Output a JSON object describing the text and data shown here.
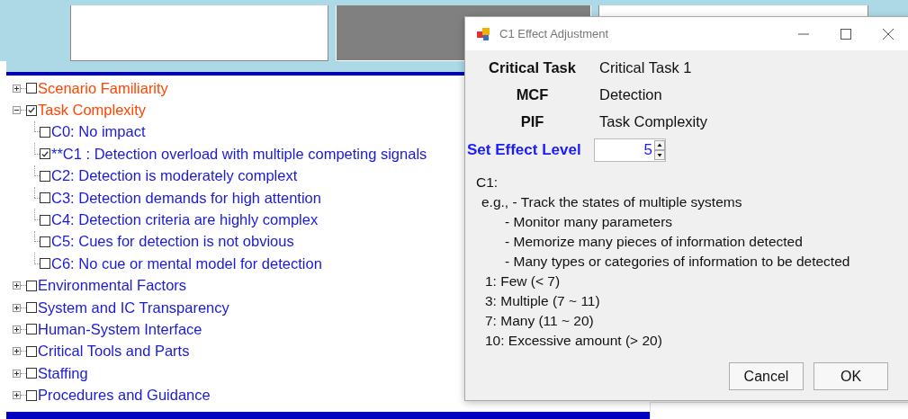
{
  "tree": [
    {
      "label": "Scenario Familiarity",
      "checked": false,
      "expanded": false,
      "color": "#ff4500"
    },
    {
      "label": "Task Complexity",
      "checked": true,
      "expanded": true,
      "color": "#ff4500",
      "children": [
        {
          "label": "C0: No impact",
          "checked": false,
          "color": "#1a1ad8"
        },
        {
          "label": "**C1 : Detection overload with multiple competing signals",
          "checked": true,
          "color": "#1a1ad8"
        },
        {
          "label": "C2: Detection is moderately complext",
          "checked": false,
          "color": "#1a1ad8"
        },
        {
          "label": "C3: Detection demands for high attention",
          "checked": false,
          "color": "#1a1ad8"
        },
        {
          "label": "C4: Detection criteria are highly complex",
          "checked": false,
          "color": "#1a1ad8"
        },
        {
          "label": "C5: Cues for detection is not obvious",
          "checked": false,
          "color": "#1a1ad8"
        },
        {
          "label": "C6: No cue or mental model for detection",
          "checked": false,
          "color": "#1a1ad8"
        }
      ]
    },
    {
      "label": "Environmental Factors",
      "checked": false,
      "expanded": false,
      "color": "#1a1ad8"
    },
    {
      "label": "System and IC Transparency",
      "checked": false,
      "expanded": false,
      "color": "#1a1ad8"
    },
    {
      "label": "Human-System Interface",
      "checked": false,
      "expanded": false,
      "color": "#1a1ad8"
    },
    {
      "label": "Critical Tools and Parts",
      "checked": false,
      "expanded": false,
      "color": "#1a1ad8"
    },
    {
      "label": "Staffing",
      "checked": false,
      "expanded": false,
      "color": "#1a1ad8"
    },
    {
      "label": "Procedures and Guidance",
      "checked": false,
      "expanded": false,
      "color": "#1a1ad8"
    }
  ],
  "dialog": {
    "title": "C1 Effect Adjustment",
    "fields": [
      {
        "label": "Critical Task",
        "value": "Critical Task 1"
      },
      {
        "label": "MCF",
        "value": "Detection"
      },
      {
        "label": "PIF",
        "value": "Task Complexity"
      }
    ],
    "effect_level": {
      "label": "Set Effect Level",
      "value": "5"
    },
    "description": [
      {
        "kind": "head",
        "text": "C1:"
      },
      {
        "kind": "example",
        "text": "e.g., - Track the states of multiple systems"
      },
      {
        "kind": "sub",
        "text": "- Monitor many parameters"
      },
      {
        "kind": "sub",
        "text": "- Memorize many pieces of information detected"
      },
      {
        "kind": "sub",
        "text": "- Many types or categories of information to be detected"
      },
      {
        "kind": "level",
        "text": "1: Few (< 7)"
      },
      {
        "kind": "level",
        "text": "3: Multiple (7 ~ 11)"
      },
      {
        "kind": "level",
        "text": "7: Many (11 ~ 20)"
      },
      {
        "kind": "level",
        "text": "10: Excessive amount (> 20)"
      }
    ],
    "buttons": [
      "Cancel",
      "OK"
    ]
  }
}
